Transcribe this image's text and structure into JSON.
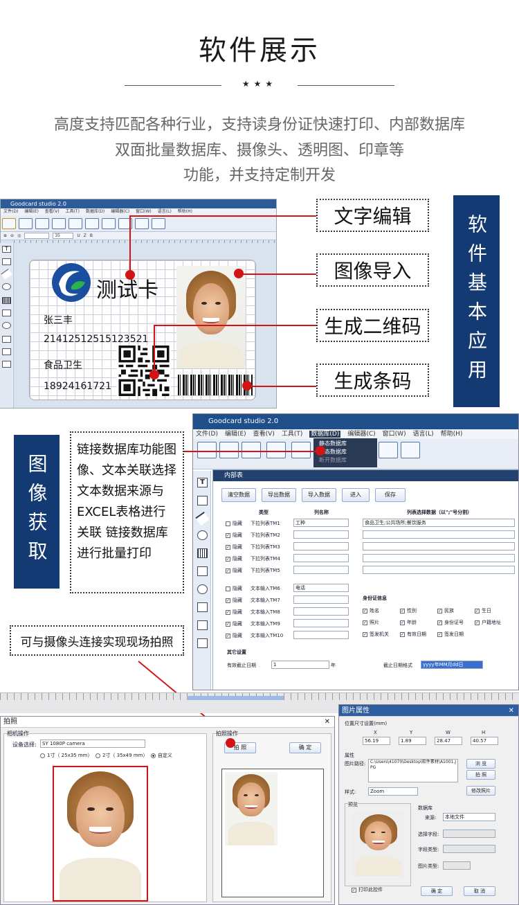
{
  "header": {
    "title": "软件展示",
    "stars": "★★★",
    "intro": [
      "高度支持匹配各种行业，支持读身份证快速打印、内部数据库",
      "双面批量数据库、摄像头、透明图、印章等",
      "功能，并支持定制开发"
    ]
  },
  "app1": {
    "title": "Goodcard studio 2.0",
    "menu": [
      "文件(D)",
      "编辑(E)",
      "查看(V)",
      "工具(T)",
      "数据库(D)",
      "编辑器(C)",
      "窗口(W)",
      "语言(L)",
      "帮助(H)"
    ],
    "zoom": "35",
    "bold_u": "U",
    "bold_z": "Z",
    "bold_b": "B"
  },
  "card": {
    "title": "测试卡",
    "name": "张三丰",
    "id": "21412512515123521",
    "org": "食品卫生",
    "phone": "18924161721"
  },
  "callouts": {
    "text_edit": "文字编辑",
    "image_import": "图像导入",
    "qr": "生成二维码",
    "barcode": "生成条码",
    "camera": "可与摄像头连接实现现场拍照",
    "db_desc": "链接数据库功能图像、文本关联选择文本数据来源与EXCEL表格进行关联 链接数据库进行批量打印"
  },
  "vlabels": {
    "basic": "软件基本应用",
    "image": "图像获取"
  },
  "app2": {
    "title": "Goodcard studio 2.0",
    "menu": [
      "文件(D)",
      "编辑(E)",
      "查看(V)",
      "工具(T)",
      "数据库(D)",
      "编辑器(C)",
      "窗口(W)",
      "语言(L)",
      "帮助(H)"
    ],
    "dbmenu": [
      "静态数据库",
      "动态数据库",
      "断开数据库"
    ]
  },
  "inner": {
    "title": "内部表",
    "buttons": [
      "清空数据",
      "导出数据",
      "导入数据",
      "进入",
      "保存"
    ],
    "col_type": "类型",
    "col_name": "列名称",
    "col_data": "列表选择数据（以\";\"号分割）",
    "rows": [
      {
        "hide": "隐藏",
        "type": "下拉列表TM1",
        "name": "工种",
        "data": "食品卫生;公共场所;餐饮服务"
      },
      {
        "hide": "隐藏",
        "type": "下拉列表TM2"
      },
      {
        "hide": "隐藏",
        "type": "下拉列表TM3"
      },
      {
        "hide": "隐藏",
        "type": "下拉列表TM4"
      },
      {
        "hide": "隐藏",
        "type": "下拉列表TM5"
      },
      {
        "hide": "隐藏",
        "type": "文本输入TM6",
        "name": "电话"
      },
      {
        "hide": "隐藏",
        "type": "文本输入TM7"
      },
      {
        "hide": "隐藏",
        "type": "文本输入TM8"
      },
      {
        "hide": "隐藏",
        "type": "文本输入TM9"
      },
      {
        "hide": "隐藏",
        "type": "文本输入TM10"
      }
    ],
    "idinfo": "身份证信息",
    "idfields": [
      [
        "姓名",
        "性别",
        "民族",
        "生日"
      ],
      [
        "照片",
        "年龄",
        "身份证号",
        "户籍地址"
      ],
      [
        "签发机关",
        "有效日期",
        "签发日期"
      ]
    ],
    "other": "其它设置",
    "valid_label": "有效截止日期",
    "valid_value": "1",
    "valid_unit": "年",
    "fmt_label": "截止日期格式",
    "fmt_value": "yyyy年MM月dd日"
  },
  "cam": {
    "title": "拍照",
    "group1": "相机操作",
    "device_label": "设备选择:",
    "device": "SY 1080P camera",
    "sizes": [
      "1寸（ 25x35 mm）",
      "2寸（ 35x49 mm）",
      "自定义"
    ],
    "group2": "拍照操作",
    "shoot": "拍 照",
    "ok": "确 定"
  },
  "prop": {
    "title": "图片属性",
    "pos": "位置尺寸设置(mm)",
    "xyzh": [
      "X",
      "Y",
      "W",
      "H"
    ],
    "vals": [
      "56.19",
      "1.89",
      "28.47",
      "40.57"
    ],
    "attr": "属性",
    "path_label": "图片路径:",
    "path": "C:\\Users\\41070\\Desktop\\软件素材\\A1001.JPG",
    "browse": "浏 览",
    "shoot": "拍 照",
    "style_label": "样式:",
    "style": "Zoom",
    "modify": "修改照片",
    "preview": "预览",
    "db": "数据库",
    "source_label": "来源:",
    "source": "本地文件",
    "field": "选择字段:",
    "ftype": "字段类型:",
    "ptype": "图片类型:",
    "print": "打印此控件",
    "ok": "确 定",
    "cancel": "取 消"
  }
}
